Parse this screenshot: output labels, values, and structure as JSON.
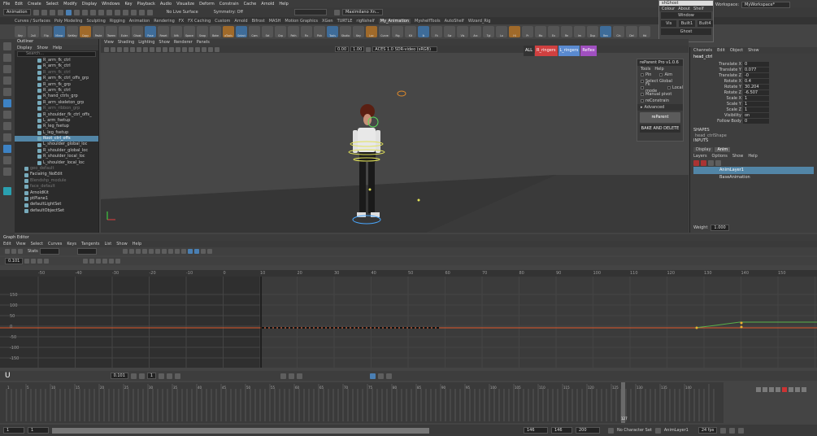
{
  "menubar": [
    "File",
    "Edit",
    "Create",
    "Select",
    "Modify",
    "Display",
    "Windows",
    "Key",
    "Playback",
    "Audio",
    "Visualize",
    "Deform",
    "Constrain",
    "Cache",
    "Arnold",
    "Help"
  ],
  "status": {
    "mode": "Animation",
    "live_surface": "No Live Surface",
    "symmetry": "Symmetry: Off",
    "character": "Maximilano Xn..."
  },
  "workspace": {
    "label": "Workspace:",
    "value": "MyWorkspace*"
  },
  "popup": {
    "title": "shGhost",
    "menus": [
      "Colour",
      "About",
      "Shelf"
    ],
    "items": [
      "Window",
      "Vis",
      "Built1",
      "Built4"
    ],
    "footer": "Ghost"
  },
  "shelf_tabs": [
    "Curves / Surfaces",
    "Poly Modeling",
    "Sculpting",
    "Rigging",
    "Animation",
    "Rendering",
    "FX",
    "FX Caching",
    "Custom",
    "Arnold",
    "Bifrost",
    "MASH",
    "Motion Graphics",
    "XGen",
    "TURTLE",
    "rigNshelf",
    "My_Animation",
    "MyshelfTools",
    "AutoShelf",
    "Wizard_Rig"
  ],
  "active_shelf_tab": "My_Animation",
  "shelf_buttons": [
    "Key",
    "2x0",
    "Flip",
    "Mirror",
    "SetKey",
    "Copy",
    "Paste",
    "Tween",
    "Euler",
    "Ghost",
    "Pose",
    "Reset",
    "Ikfk",
    "Space",
    "Snap",
    "Bake",
    "aTools",
    "Select",
    "Cam",
    "Sel",
    "Grp",
    "Path",
    "Fix",
    "Pick",
    "Tools",
    "Studio",
    "Key",
    "Loc",
    "Curve",
    "Rig",
    "Kit",
    "Ik",
    "Fk",
    "Sw",
    "Vis",
    "Arc",
    "Tgl",
    "Lo",
    "Hi",
    "Pr",
    "Mo",
    "Ex",
    "Re",
    "Im",
    "Dup",
    "Ren",
    "Cln",
    "Del",
    "Hd"
  ],
  "outliner": {
    "title": "Outliner",
    "menus": [
      "Display",
      "Show",
      "Help"
    ],
    "search_placeholder": "Search...",
    "items": [
      {
        "label": "R_arm_fk_ctrl",
        "state": "normal"
      },
      {
        "label": "R_arm_fk_ctrl",
        "state": "normal"
      },
      {
        "label": "R_arm_fk_ctrl",
        "state": "dim"
      },
      {
        "label": "R_arm_fk_ctrl_offs_grp",
        "state": "normal"
      },
      {
        "label": "R_arm_fk_grp",
        "state": "normal"
      },
      {
        "label": "R_arm_fk_ctrl",
        "state": "normal"
      },
      {
        "label": "R_hand_ctrls_grp",
        "state": "normal"
      },
      {
        "label": "R_arm_skeleton_grp",
        "state": "normal"
      },
      {
        "label": "R_arm_ribbon_grp",
        "state": "dim"
      },
      {
        "label": "R_shoulder_fk_ctrl_offs_",
        "state": "normal"
      },
      {
        "label": "L_arm_fsetup",
        "state": "normal"
      },
      {
        "label": "R_leg_fsetup",
        "state": "normal"
      },
      {
        "label": "L_leg_fsetup",
        "state": "normal"
      },
      {
        "label": "Root_ctrl_offs",
        "state": "selected"
      },
      {
        "label": "L_shoulder_global_loc",
        "state": "normal"
      },
      {
        "label": "R_shoulder_global_loc",
        "state": "normal"
      },
      {
        "label": "R_shoulder_local_loc",
        "state": "normal"
      },
      {
        "label": "L_shoulder_local_loc",
        "state": "normal"
      },
      {
        "label": "geo_default",
        "state": "dim"
      },
      {
        "label": "Facialrig_NoEdit",
        "state": "normal"
      },
      {
        "label": "Blendshp_module",
        "state": "dim"
      },
      {
        "label": "face_default",
        "state": "dim"
      },
      {
        "label": "ArnoldKit",
        "state": "normal"
      },
      {
        "label": "ptPlane1",
        "state": "normal"
      },
      {
        "label": "defaultLightSet",
        "state": "normal"
      },
      {
        "label": "defaultObjectSet",
        "state": "normal"
      }
    ]
  },
  "viewport": {
    "menus": [
      "View",
      "Shading",
      "Lighting",
      "Show",
      "Renderer",
      "Panels"
    ],
    "near": "0.00",
    "far": "1.00",
    "colorspace": "ACES 1.0 SDR-video (sRGB)",
    "tags": [
      "ALL",
      "R_ringers",
      "L_ringers",
      "Reflex"
    ]
  },
  "reparent": {
    "title": "reParent Pro v1.0.6",
    "menus": [
      "Tools",
      "Help"
    ],
    "options": [
      "Pin",
      "Aim",
      "Select Global",
      "Fk mode",
      "Local",
      "Manual pivot",
      "reConstrain",
      "Advanced"
    ],
    "button": "reParent",
    "bake_button": "BAKE AND DELETE"
  },
  "channelbox": {
    "menus": [
      "Channels",
      "Edit",
      "Object",
      "Show"
    ],
    "object": "head_ctrl",
    "channels": [
      {
        "name": "Translate X",
        "value": "0"
      },
      {
        "name": "Translate Y",
        "value": "0.077"
      },
      {
        "name": "Translate Z",
        "value": "-0"
      },
      {
        "name": "Rotate X",
        "value": "0.4"
      },
      {
        "name": "Rotate Y",
        "value": "30.204"
      },
      {
        "name": "Rotate Z",
        "value": "-6.507"
      },
      {
        "name": "Scale X",
        "value": "1"
      },
      {
        "name": "Scale Y",
        "value": "1"
      },
      {
        "name": "Scale Z",
        "value": "1"
      },
      {
        "name": "Visibility",
        "value": "on"
      },
      {
        "name": "Follow Body",
        "value": "0"
      }
    ],
    "shapes_label": "SHAPES",
    "shape": "head_ctrlShape",
    "inputs_label": "INPUTS",
    "layer_tabs": [
      "Display",
      "Anim"
    ],
    "layer_menus": [
      "Layers",
      "Options",
      "Show",
      "Help"
    ],
    "layers": [
      {
        "name": "AnimLayer1",
        "selected": true
      },
      {
        "name": "BaseAnimation",
        "selected": false
      }
    ],
    "weight_label": "Weight",
    "weight": "1.000"
  },
  "graph_editor": {
    "title": "Graph Editor",
    "menus": [
      "Edit",
      "View",
      "Select",
      "Curves",
      "Keys",
      "Tangents",
      "List",
      "Show",
      "Help"
    ],
    "stats_label": "Stats",
    "value_field": "0.101",
    "ruler": [
      "-50",
      "-40",
      "-30",
      "-20",
      "-10",
      "0",
      "10",
      "20",
      "30",
      "40",
      "50",
      "60",
      "70",
      "80",
      "90",
      "100",
      "110",
      "120",
      "130",
      "140",
      "150"
    ],
    "y_labels": [
      "150",
      "100",
      "50",
      "0",
      "-50",
      "-100",
      "-150"
    ]
  },
  "timeline": {
    "step": "0.101",
    "frame": "1",
    "ticks": [
      "1",
      "5",
      "10",
      "15",
      "20",
      "25",
      "30",
      "35",
      "40",
      "45",
      "50",
      "55",
      "60",
      "65",
      "70",
      "75",
      "80",
      "85",
      "90",
      "95",
      "100",
      "105",
      "110",
      "115",
      "120",
      "125",
      "130",
      "135",
      "140"
    ],
    "current": "127"
  },
  "range": {
    "start": "1",
    "inner_start": "1",
    "inner_end": "146",
    "end": "146",
    "max": "200",
    "character_set": "No Character Set",
    "anim_layer": "AnimLayer1",
    "fps": "24 fps"
  },
  "colors": {
    "accent": "#5285a6",
    "curve": "#e05a2b",
    "key": "#f0b030"
  }
}
